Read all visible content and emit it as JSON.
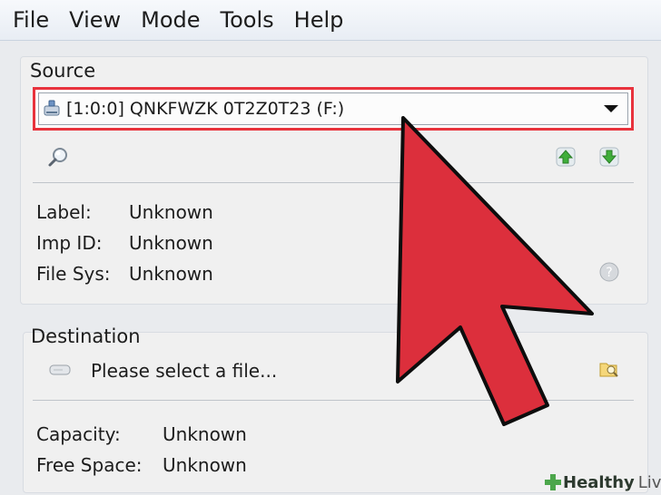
{
  "menu": [
    "File",
    "View",
    "Mode",
    "Tools",
    "Help"
  ],
  "source": {
    "title": "Source",
    "selected_device": "[1:0:0] QNKFWZK 0T2Z0T23 (F:)",
    "label_caption": "Label:",
    "label_value": "Unknown",
    "imp_id_caption": "Imp ID:",
    "imp_id_value": "Unknown",
    "file_sys_caption": "File Sys:",
    "file_sys_value": "Unknown"
  },
  "destination": {
    "title": "Destination",
    "file_placeholder": "Please select a file...",
    "capacity_caption": "Capacity:",
    "capacity_value": "Unknown",
    "free_space_caption": "Free Space:",
    "free_space_value": "Unknown"
  },
  "watermark": {
    "word1": "Healthy",
    "word2": "Living"
  },
  "colors": {
    "highlight": "#e8333d",
    "arrow": "#dc2f3c",
    "up_green": "#3fae3a"
  },
  "icons": [
    "drive-icon",
    "search-icon",
    "move-up-icon",
    "move-down-icon",
    "help-icon",
    "disk-icon",
    "browse-folder-icon",
    "arrow-pointer"
  ]
}
